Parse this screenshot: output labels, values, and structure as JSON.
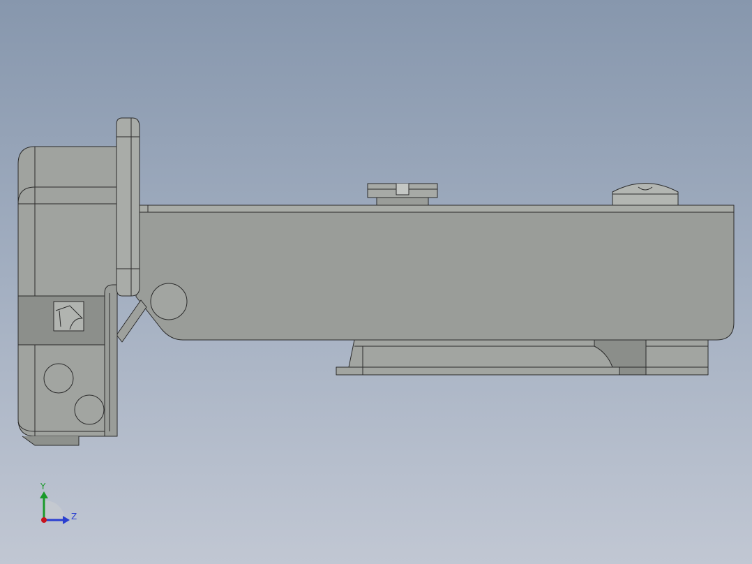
{
  "viewport": {
    "background_top": "#8797ad",
    "background_bottom": "#c1c7d3",
    "model_color": "#9ea19d",
    "edge_color": "#2a2a2a"
  },
  "triad": {
    "y_label": "Y",
    "z_label": "Z",
    "y_color": "#1a9a2a",
    "z_color": "#2a3fd0",
    "x_color": "#c8141e"
  }
}
